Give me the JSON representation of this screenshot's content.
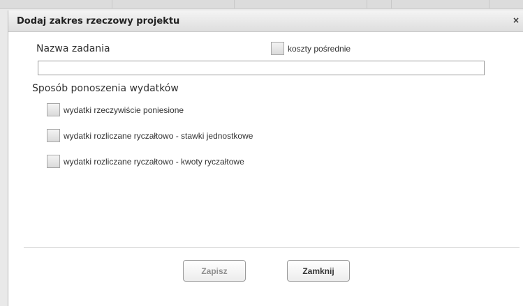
{
  "dialog": {
    "title": "Dodaj zakres rzeczowy projektu",
    "close_label": "×"
  },
  "form": {
    "task_name_label": "Nazwa zadania",
    "task_name_value": "",
    "indirect_costs_label": "koszty pośrednie",
    "indirect_costs_checked": false,
    "expense_method_label": "Sposób ponoszenia wydatków",
    "expense_options": [
      {
        "label": "wydatki rzeczywiście poniesione",
        "checked": false
      },
      {
        "label": "wydatki rozliczane ryczałtowo - stawki jednostkowe",
        "checked": false
      },
      {
        "label": "wydatki rozliczane ryczałtowo - kwoty ryczałtowe",
        "checked": false
      }
    ]
  },
  "buttons": {
    "save_label": "Zapisz",
    "save_enabled": false,
    "close_label": "Zamknij"
  }
}
